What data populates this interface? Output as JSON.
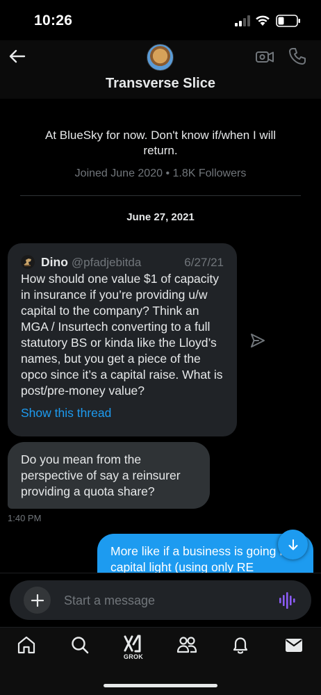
{
  "status_bar": {
    "time": "10:26"
  },
  "header": {
    "title": "Transverse Slice"
  },
  "profile": {
    "bio": "At BlueSky for now. Don't know if/when I will return.",
    "meta": "Joined June 2020 • 1.8K Followers"
  },
  "date_separator": "June 27, 2021",
  "quoted_post": {
    "author_name": "Dino",
    "author_handle": "@pfadjebitda",
    "date": "6/27/21",
    "text": "How should one value $1 of capacity in insurance if you’re providing u/w capital to the company? Think an MGA / Insurtech converting to a full statutory BS or kinda like the Lloyd’s names, but you get a piece of the opco since it’s a capital raise. What is post/pre-money value?",
    "link_label": "Show this thread"
  },
  "reply_message": {
    "text": "Do you mean from the perspective of say a reinsurer providing a quota share?",
    "time": "1:40 PM"
  },
  "outgoing_message": {
    "text": "More like if a business is going from capital light (using only RE"
  },
  "composer": {
    "placeholder": "Start a message"
  },
  "tabs": [
    {
      "icon": "home-icon"
    },
    {
      "icon": "search-icon"
    },
    {
      "icon": "grok-icon",
      "label": "GROK"
    },
    {
      "icon": "communities-icon"
    },
    {
      "icon": "notifications-icon"
    },
    {
      "icon": "messages-icon"
    }
  ],
  "colors": {
    "accent": "#1d9bf0",
    "background": "#000000",
    "bubble_incoming": "#2f3336",
    "secondary_text": "#71767b",
    "voice_icon": "#8b5cf6"
  }
}
